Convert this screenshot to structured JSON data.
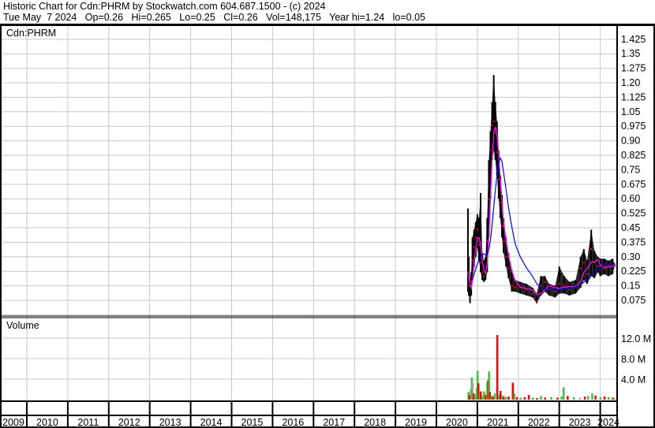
{
  "header": {
    "title": "Historic Chart for Cdn:PHRM by Stockwatch.com 604.687.1500 - (c) 2024",
    "quote": "Tue May  7 2024   Op=0.26   Hi=0.265   Lo=0.25   Cl=0.26   Vol=148,175   Year hi=1.24   lo=0.05"
  },
  "chart_data": {
    "type": "line",
    "symbol_label": "Cdn:PHRM",
    "volume_label": "Volume",
    "price_axis": {
      "ylim": [
        0,
        1.45
      ],
      "ticks": [
        "1.425",
        "1.35",
        "1.275",
        "1.20",
        "1.125",
        "1.05",
        "0.975",
        "0.90",
        "0.825",
        "0.75",
        "0.675",
        "0.60",
        "0.525",
        "0.45",
        "0.375",
        "0.30",
        "0.225",
        "0.15",
        "0.075"
      ]
    },
    "volume_axis": {
      "ylim_millions": [
        0,
        14
      ],
      "ticks": [
        {
          "value": 12,
          "label": "12.0 M"
        },
        {
          "value": 8,
          "label": "8.0 M"
        },
        {
          "value": 4,
          "label": "4.0 M"
        }
      ]
    },
    "x_axis": {
      "years": [
        "2009",
        "2010",
        "2011",
        "2012",
        "2013",
        "2014",
        "2015",
        "2016",
        "2017",
        "2018",
        "2019",
        "2020",
        "2021",
        "2022",
        "2023",
        "2024"
      ]
    },
    "colors": {
      "bars": "#000000",
      "close": "#ff0000",
      "ma_short": "#ff00ff",
      "ma_long": "#0000ff",
      "vol_up": "#44bb44",
      "vol_down": "#ff0000",
      "vol_flat": "#a0a0a0",
      "grid": "#c8c8c8"
    },
    "price_series_columns": [
      "year_fraction",
      "low",
      "high",
      "close"
    ],
    "price_series": [
      [
        2020.77,
        0.12,
        0.55,
        0.22
      ],
      [
        2020.79,
        0.1,
        0.3,
        0.15
      ],
      [
        2020.82,
        0.06,
        0.18,
        0.09
      ],
      [
        2020.85,
        0.1,
        0.22,
        0.17
      ],
      [
        2020.88,
        0.18,
        0.4,
        0.28
      ],
      [
        2020.92,
        0.25,
        0.44,
        0.35
      ],
      [
        2020.96,
        0.3,
        0.48,
        0.4
      ],
      [
        2021.0,
        0.35,
        0.52,
        0.44
      ],
      [
        2021.04,
        0.28,
        0.5,
        0.36
      ],
      [
        2021.08,
        0.22,
        0.63,
        0.27
      ],
      [
        2021.12,
        0.18,
        0.32,
        0.22
      ],
      [
        2021.16,
        0.17,
        0.28,
        0.2
      ],
      [
        2021.2,
        0.18,
        0.3,
        0.22
      ],
      [
        2021.24,
        0.22,
        0.5,
        0.38
      ],
      [
        2021.28,
        0.4,
        0.8,
        0.6
      ],
      [
        2021.32,
        0.6,
        0.95,
        0.85
      ],
      [
        2021.36,
        0.8,
        1.1,
        0.98
      ],
      [
        2021.4,
        0.85,
        1.24,
        1.0
      ],
      [
        2021.44,
        0.8,
        1.1,
        0.94
      ],
      [
        2021.48,
        0.72,
        1.0,
        0.84
      ],
      [
        2021.52,
        0.6,
        0.85,
        0.7
      ],
      [
        2021.56,
        0.5,
        0.72,
        0.58
      ],
      [
        2021.6,
        0.4,
        0.62,
        0.46
      ],
      [
        2021.64,
        0.32,
        0.5,
        0.38
      ],
      [
        2021.7,
        0.25,
        0.4,
        0.3
      ],
      [
        2021.76,
        0.19,
        0.32,
        0.24
      ],
      [
        2021.84,
        0.12,
        0.22,
        0.15
      ],
      [
        2021.92,
        0.12,
        0.18,
        0.14
      ],
      [
        2022.05,
        0.11,
        0.17,
        0.14
      ],
      [
        2022.2,
        0.1,
        0.16,
        0.13
      ],
      [
        2022.35,
        0.09,
        0.14,
        0.11
      ],
      [
        2022.45,
        0.06,
        0.11,
        0.07
      ],
      [
        2022.55,
        0.1,
        0.2,
        0.15
      ],
      [
        2022.65,
        0.12,
        0.2,
        0.17
      ],
      [
        2022.75,
        0.1,
        0.16,
        0.13
      ],
      [
        2022.9,
        0.09,
        0.15,
        0.12
      ],
      [
        2023.0,
        0.11,
        0.25,
        0.16
      ],
      [
        2023.12,
        0.11,
        0.2,
        0.15
      ],
      [
        2023.25,
        0.1,
        0.17,
        0.13
      ],
      [
        2023.4,
        0.11,
        0.18,
        0.15
      ],
      [
        2023.52,
        0.14,
        0.3,
        0.24
      ],
      [
        2023.6,
        0.18,
        0.34,
        0.27
      ],
      [
        2023.68,
        0.16,
        0.28,
        0.21
      ],
      [
        2023.78,
        0.2,
        0.44,
        0.34
      ],
      [
        2023.86,
        0.19,
        0.33,
        0.27
      ],
      [
        2023.94,
        0.22,
        0.3,
        0.25
      ],
      [
        2024.0,
        0.2,
        0.29,
        0.25
      ],
      [
        2024.1,
        0.21,
        0.29,
        0.24
      ],
      [
        2024.2,
        0.2,
        0.28,
        0.25
      ],
      [
        2024.3,
        0.21,
        0.29,
        0.26
      ],
      [
        2024.35,
        0.25,
        0.265,
        0.26
      ]
    ],
    "volume_series_columns": [
      "year_fraction",
      "volume_millions",
      "direction"
    ],
    "volume_series": [
      [
        2020.78,
        1.5,
        "up"
      ],
      [
        2020.8,
        0.9,
        "down"
      ],
      [
        2020.84,
        2.0,
        "up"
      ],
      [
        2020.86,
        4.3,
        "up"
      ],
      [
        2020.88,
        3.2,
        "flat"
      ],
      [
        2020.9,
        1.2,
        "down"
      ],
      [
        2020.94,
        1.0,
        "up"
      ],
      [
        2020.98,
        2.3,
        "up"
      ],
      [
        2021.0,
        5.6,
        "up"
      ],
      [
        2021.02,
        3.2,
        "down"
      ],
      [
        2021.05,
        1.0,
        "up"
      ],
      [
        2021.08,
        1.6,
        "down"
      ],
      [
        2021.12,
        0.7,
        "up"
      ],
      [
        2021.16,
        1.6,
        "up"
      ],
      [
        2021.2,
        0.9,
        "down"
      ],
      [
        2021.24,
        3.5,
        "up"
      ],
      [
        2021.26,
        3.8,
        "down"
      ],
      [
        2021.28,
        5.5,
        "up"
      ],
      [
        2021.3,
        1.5,
        "down"
      ],
      [
        2021.34,
        0.8,
        "up"
      ],
      [
        2021.38,
        0.6,
        "down"
      ],
      [
        2021.42,
        1.2,
        "up"
      ],
      [
        2021.48,
        12.6,
        "down"
      ],
      [
        2021.52,
        1.0,
        "up"
      ],
      [
        2021.56,
        1.7,
        "down"
      ],
      [
        2021.6,
        0.8,
        "up"
      ],
      [
        2021.64,
        0.6,
        "down"
      ],
      [
        2021.7,
        0.5,
        "up"
      ],
      [
        2021.76,
        0.6,
        "down"
      ],
      [
        2021.86,
        3.3,
        "down"
      ],
      [
        2021.9,
        1.2,
        "up"
      ],
      [
        2021.96,
        0.5,
        "down"
      ],
      [
        2022.05,
        0.4,
        "up"
      ],
      [
        2022.15,
        0.5,
        "down"
      ],
      [
        2022.25,
        0.9,
        "down"
      ],
      [
        2022.35,
        0.4,
        "up"
      ],
      [
        2022.45,
        0.3,
        "down"
      ],
      [
        2022.55,
        0.7,
        "up"
      ],
      [
        2022.65,
        0.4,
        "down"
      ],
      [
        2022.8,
        0.5,
        "up"
      ],
      [
        2022.95,
        0.4,
        "down"
      ],
      [
        2023.05,
        0.6,
        "up"
      ],
      [
        2023.1,
        2.4,
        "up"
      ],
      [
        2023.2,
        0.7,
        "down"
      ],
      [
        2023.35,
        0.5,
        "up"
      ],
      [
        2023.5,
        0.4,
        "flat"
      ],
      [
        2023.62,
        0.6,
        "down"
      ],
      [
        2023.7,
        0.7,
        "up"
      ],
      [
        2023.8,
        1.2,
        "up"
      ],
      [
        2023.88,
        0.8,
        "down"
      ],
      [
        2024.0,
        0.5,
        "up"
      ],
      [
        2024.1,
        0.6,
        "down"
      ],
      [
        2024.2,
        0.5,
        "up"
      ],
      [
        2024.3,
        0.4,
        "down"
      ],
      [
        2024.35,
        0.15,
        "up"
      ]
    ],
    "ma_short_window": 3,
    "ma_long_window": 8
  }
}
